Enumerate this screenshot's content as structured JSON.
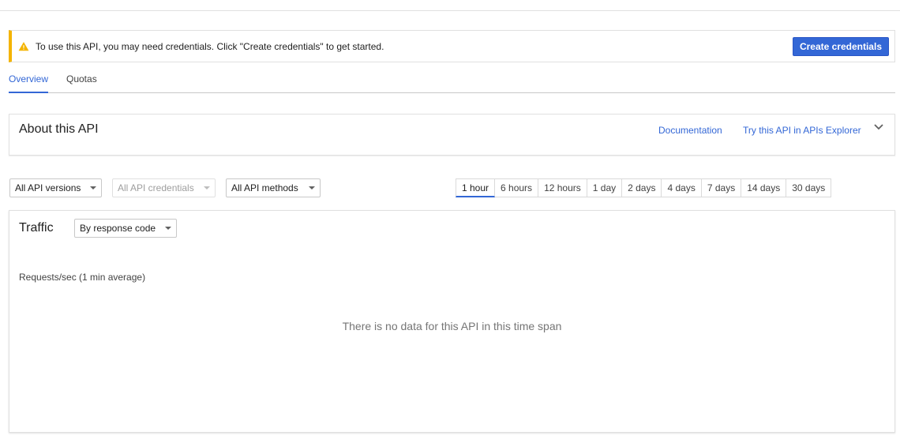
{
  "banner": {
    "message": "To use this API, you may need credentials. Click \"Create credentials\" to get started.",
    "button_label": "Create credentials",
    "icon": "warning-icon",
    "accent_color": "#f4b400"
  },
  "tabs": [
    {
      "label": "Overview",
      "active": true
    },
    {
      "label": "Quotas",
      "active": false
    }
  ],
  "about": {
    "title": "About this API",
    "documentation_link": "Documentation",
    "explorer_link": "Try this API in APIs Explorer",
    "expand_icon": "chevron-down-icon"
  },
  "filters": {
    "versions": "All API versions",
    "credentials": "All API credentials",
    "methods": "All API methods"
  },
  "time_ranges": {
    "selected": "1 hour",
    "options": [
      "1 hour",
      "6 hours",
      "12 hours",
      "1 day",
      "2 days",
      "4 days",
      "7 days",
      "14 days",
      "30 days"
    ]
  },
  "traffic": {
    "title": "Traffic",
    "group_by": "By response code",
    "y_label": "Requests/sec (1 min average)",
    "empty_message": "There is no data for this API in this time span"
  },
  "colors": {
    "primary": "#3367d6",
    "warning": "#f4b400"
  }
}
